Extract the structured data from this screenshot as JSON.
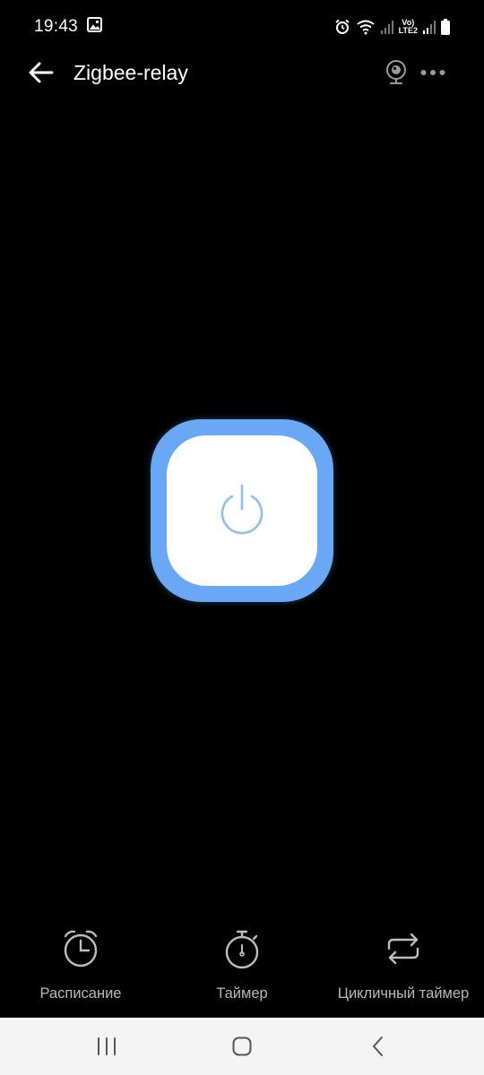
{
  "status_bar": {
    "time": "19:43",
    "lte_top": "Vo)",
    "lte_bottom": "LTE2",
    "icons": [
      "gallery-icon",
      "alarm-icon",
      "wifi-icon",
      "signal-icon",
      "signal-icon",
      "battery-icon"
    ]
  },
  "app_bar": {
    "title": "Zigbee-relay",
    "back_icon": "arrow-left-icon",
    "camera_icon": "camera-icon",
    "more_icon": "more-horizontal-icon"
  },
  "power_button": {
    "icon": "power-icon",
    "outer_color": "#6aa8f6",
    "icon_color": "#8fc0f0"
  },
  "actions": [
    {
      "label": "Расписание",
      "icon": "alarm-clock-icon"
    },
    {
      "label": "Таймер",
      "icon": "stopwatch-icon"
    },
    {
      "label": "Цикличный таймер",
      "icon": "repeat-icon"
    }
  ],
  "nav_bar": {
    "icons": [
      "recent-apps-icon",
      "home-icon",
      "back-icon"
    ]
  }
}
